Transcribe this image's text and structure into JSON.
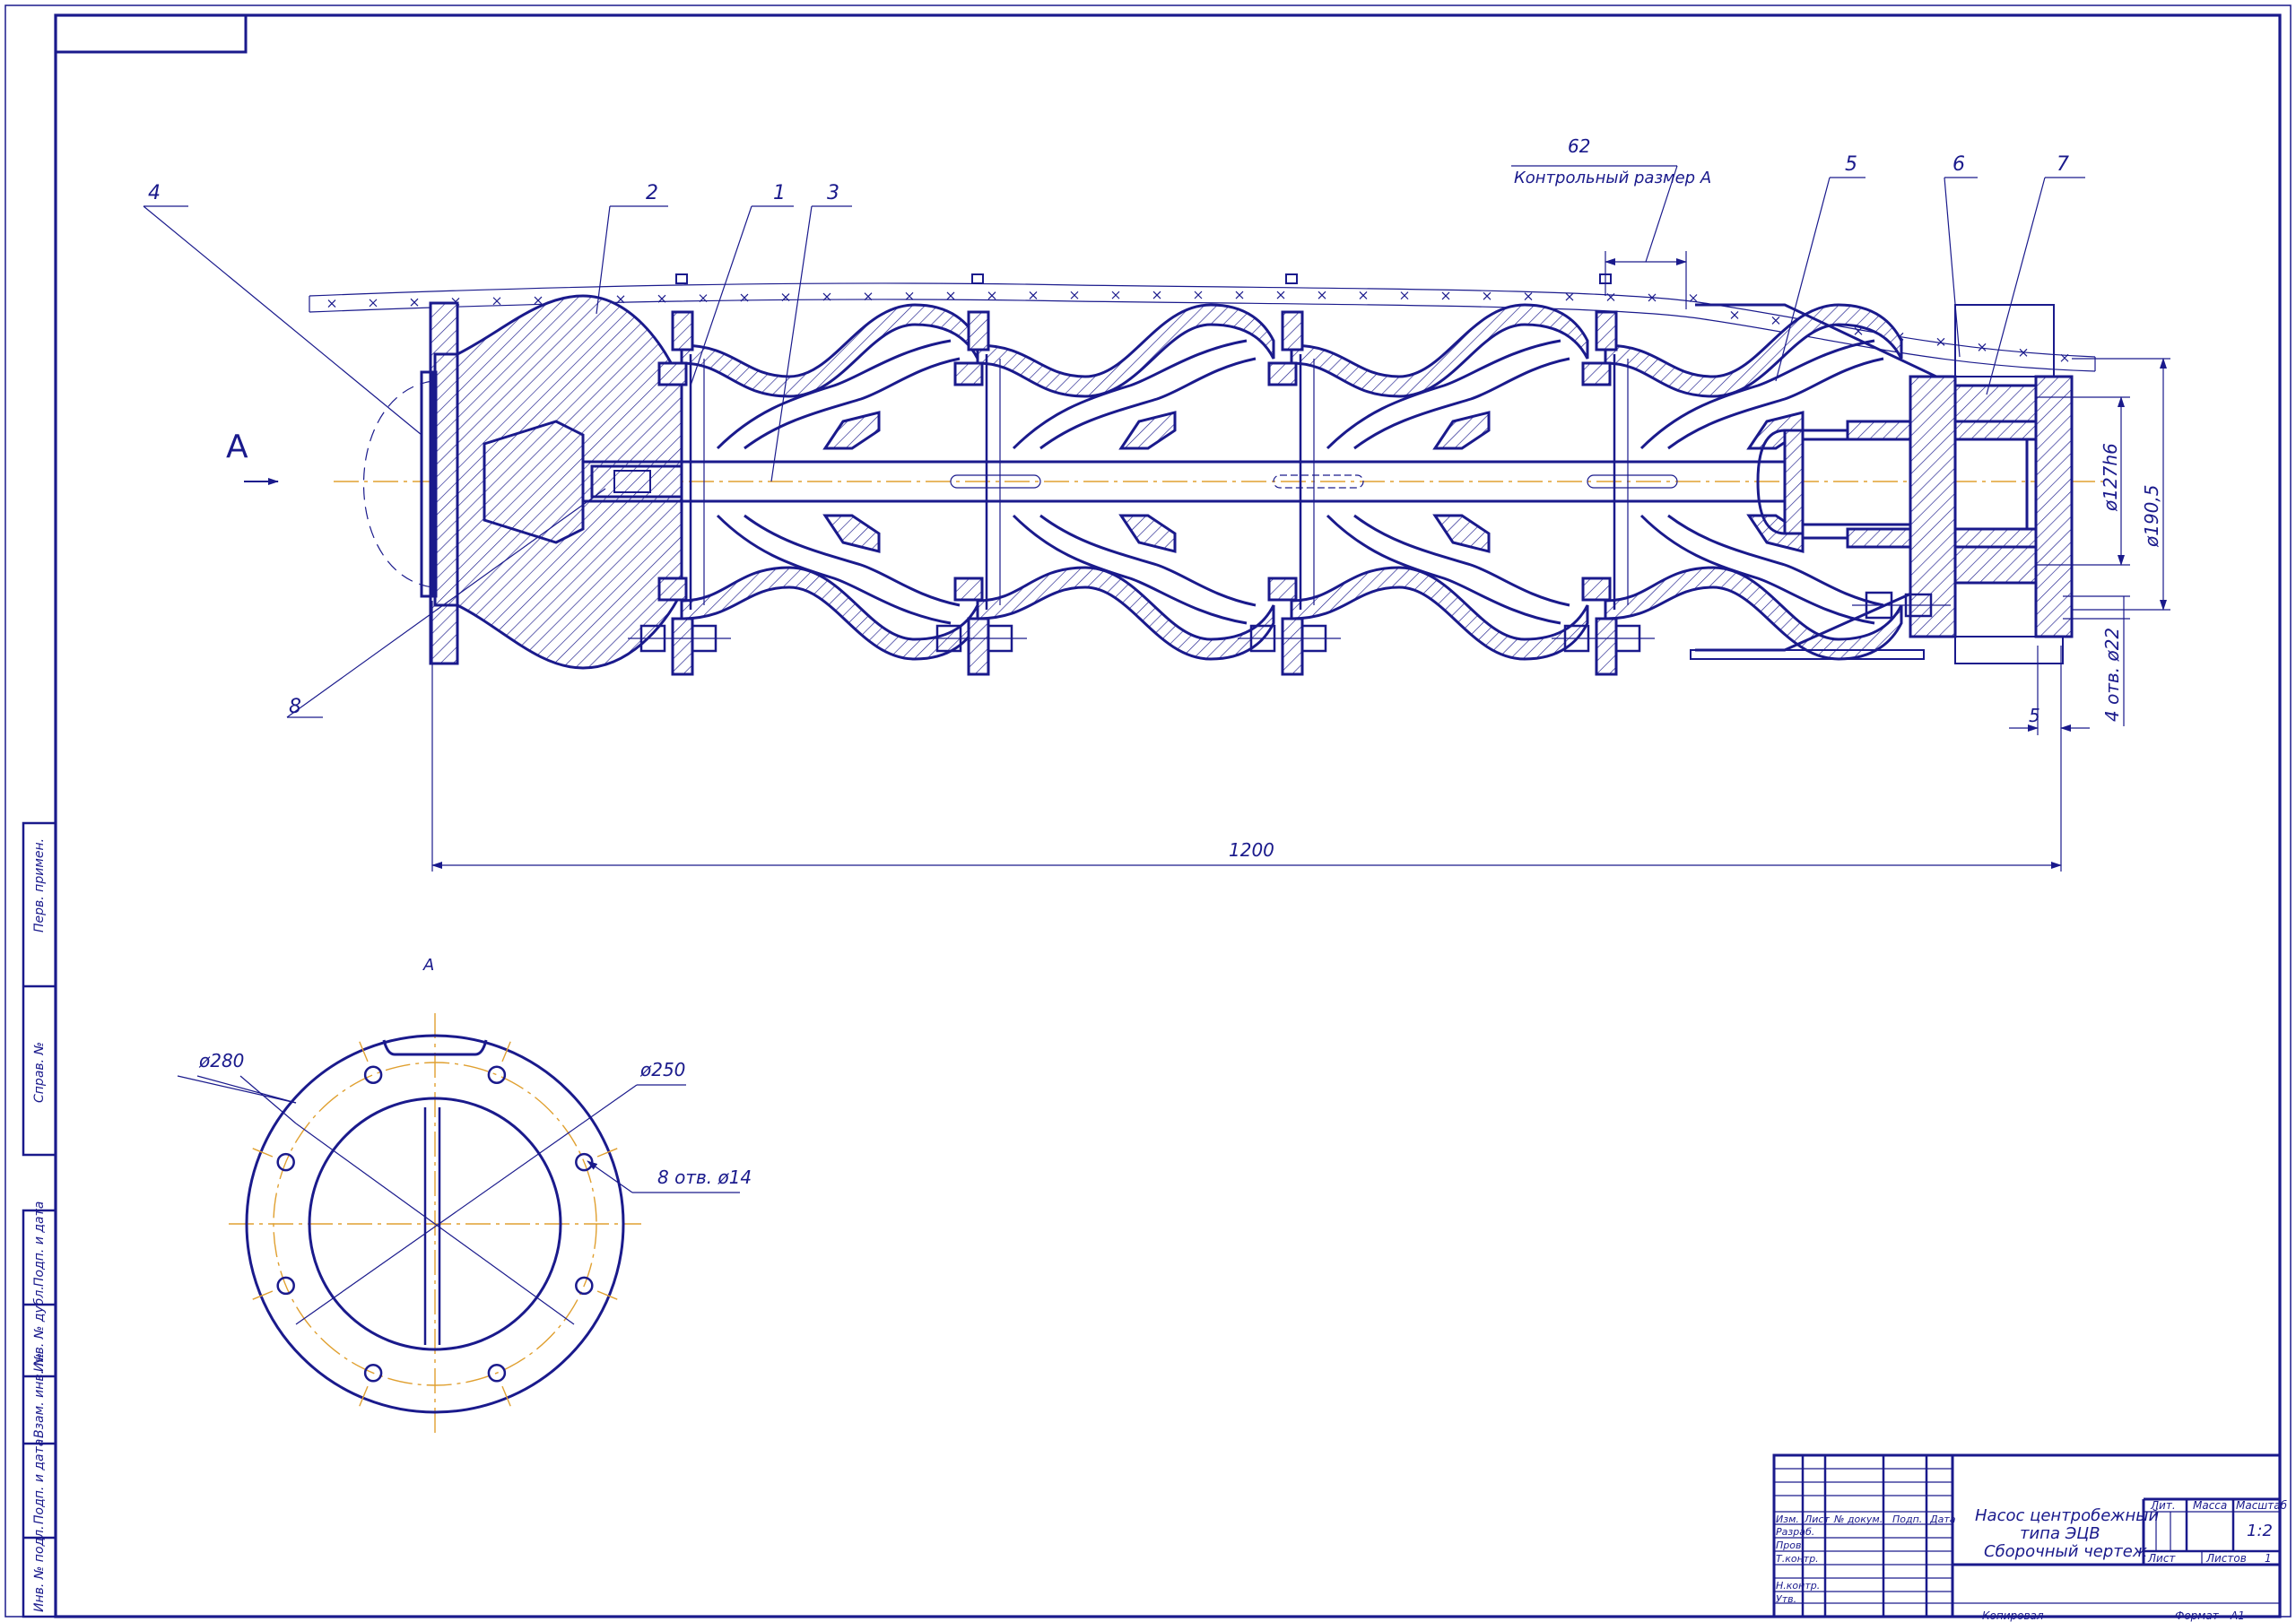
{
  "drawing": {
    "position_labels": [
      "4",
      "2",
      "1",
      "3",
      "5",
      "6",
      "7",
      "8"
    ],
    "view_arrow_label": "А",
    "view_title": "А",
    "control_dimension": {
      "value": "62",
      "label": "Контрольный размер А"
    },
    "dimensions": {
      "overall_length": "1200",
      "flange_offset": "5",
      "dia_127": "ø127h6",
      "dia_190": "ø190,5",
      "holes_right": "4 отв. ø22",
      "dia_280": "ø280",
      "dia_250": "ø250",
      "holes_flange": "8 отв. ø14"
    }
  },
  "side_stamp": {
    "cells": [
      "Перв. примен.",
      "Справ. №",
      "Подп. и дата",
      "Инв. № дубл.",
      "Взам. инв. №",
      "Подп. и дата",
      "Инв. № подл."
    ]
  },
  "title_block": {
    "title_lines": [
      "Насос центробежный",
      "типа ЭЦВ",
      "Сборочный чертеж"
    ],
    "header_cells": [
      "Изм.",
      "Лист",
      "№ докум.",
      "Подп.",
      "Дата"
    ],
    "role_rows": [
      "Разраб.",
      "Пров.",
      "Т.контр.",
      "Н.контр.",
      "Утв."
    ],
    "lit_label": "Лит.",
    "mass_label": "Масса",
    "scale_label": "Масштаб",
    "scale_value": "1:2",
    "sheet_label": "Лист",
    "sheets_label": "Листов",
    "sheets_value": "1",
    "copied_label": "Копировал",
    "format_label": "Формат",
    "format_value": "А1"
  }
}
